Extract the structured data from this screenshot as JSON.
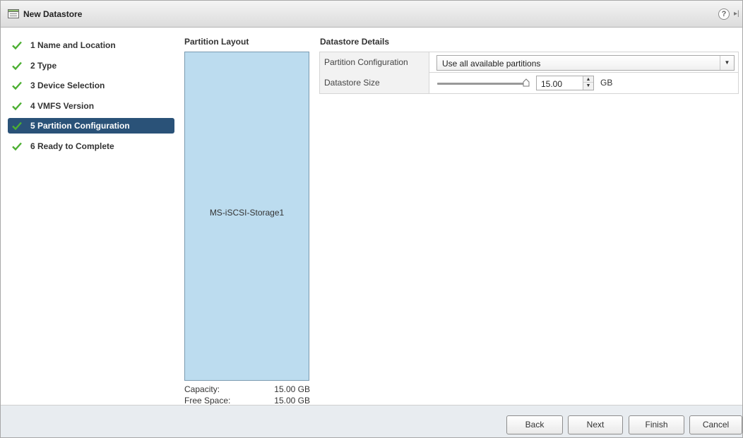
{
  "window": {
    "title": "New Datastore",
    "help_symbol": "?",
    "expand_symbol": "▸|"
  },
  "steps": [
    {
      "number": "1",
      "label": "1 Name and Location",
      "done": true
    },
    {
      "number": "2",
      "label": "2 Type",
      "done": true
    },
    {
      "number": "3",
      "label": "3 Device Selection",
      "done": true
    },
    {
      "number": "4",
      "label": "4 VMFS Version",
      "done": true
    },
    {
      "number": "5",
      "label": "5 Partition Configuration",
      "done": true,
      "active": true
    },
    {
      "number": "6",
      "label": "6 Ready to Complete",
      "done": true
    }
  ],
  "partition_layout": {
    "header": "Partition Layout",
    "partition_name": "MS-iSCSI-Storage1",
    "capacity_label": "Capacity:",
    "capacity_value": "15.00 GB",
    "free_space_label": "Free Space:",
    "free_space_value": "15.00 GB"
  },
  "details": {
    "header": "Datastore Details",
    "partition_config_label": "Partition Configuration",
    "partition_config_value": "Use all available partitions",
    "size_label": "Datastore Size",
    "size_value": "15.00",
    "size_unit": "GB",
    "size_slider_fraction": 1.0
  },
  "footer": {
    "back": "Back",
    "next": "Next",
    "finish": "Finish",
    "cancel": "Cancel"
  },
  "colors": {
    "active_step_bg": "#2a5278",
    "check_green": "#4caf32",
    "partition_fill": "#bcdcef",
    "footer_bg": "#e8ecf0"
  }
}
